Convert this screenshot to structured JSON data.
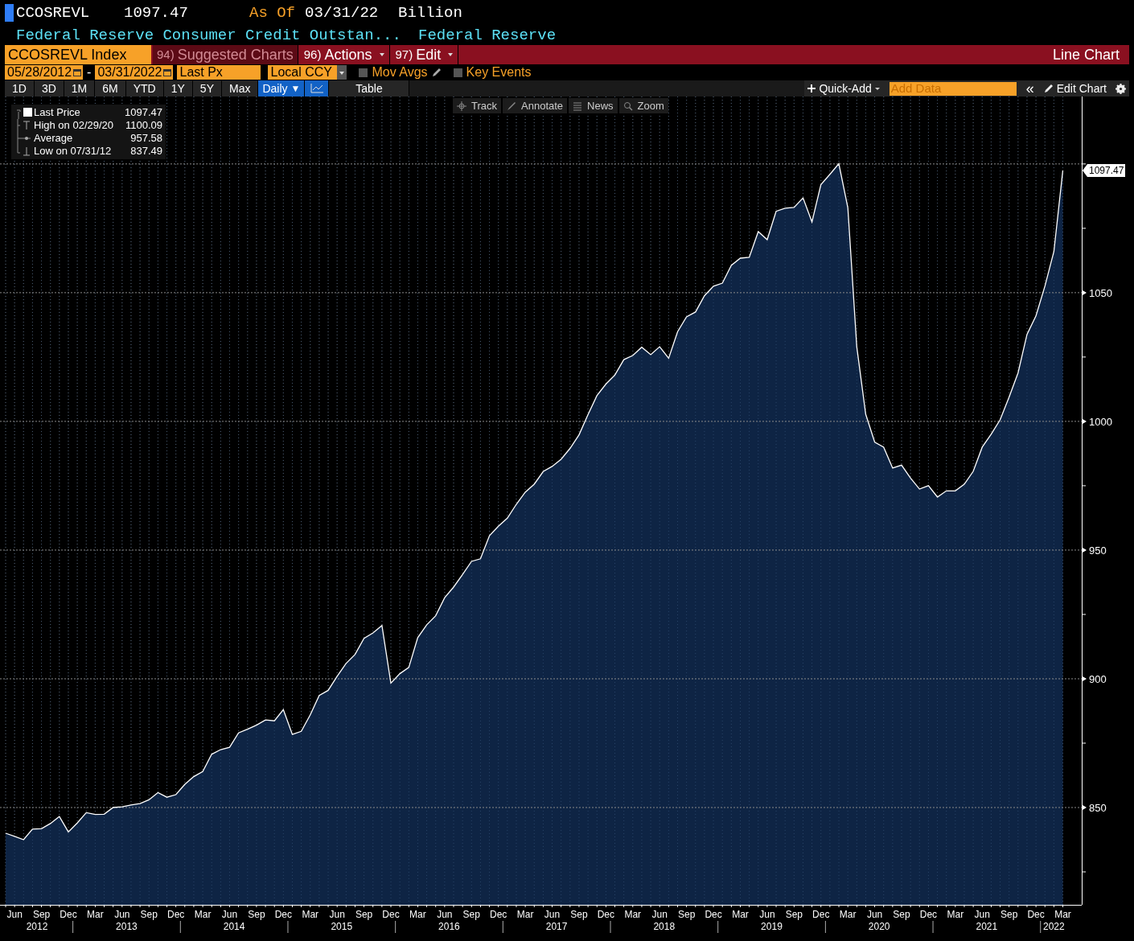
{
  "header": {
    "ticker": "CCOSREVL",
    "price": "1097.47",
    "as_of_label": "As Of",
    "as_of_date": "03/31/22",
    "units": "Billion",
    "description": "Federal Reserve Consumer Credit Outstan...",
    "source": "Federal Reserve"
  },
  "toolbar": {
    "security": "CCOSREVL Index",
    "menus": [
      {
        "number": "94)",
        "label": "Suggested Charts",
        "disabled": true,
        "dropdown": false
      },
      {
        "number": "96)",
        "label": "Actions",
        "disabled": false,
        "dropdown": true
      },
      {
        "number": "97)",
        "label": "Edit",
        "disabled": false,
        "dropdown": true
      }
    ],
    "chart_type": "Line Chart"
  },
  "range": {
    "start": "05/28/2012",
    "separator": "-",
    "end": "03/31/2022",
    "field": "Last Px",
    "currency": "Local CCY",
    "options": [
      {
        "label": "Mov Avgs",
        "checked": false,
        "kind": "pencil"
      },
      {
        "label": "Key Events",
        "checked": false,
        "kind": "plain"
      }
    ]
  },
  "periods": [
    {
      "label": "1D",
      "selected": false
    },
    {
      "label": "3D",
      "selected": false
    },
    {
      "label": "1M",
      "selected": false
    },
    {
      "label": "6M",
      "selected": false
    },
    {
      "label": "YTD",
      "selected": false
    },
    {
      "label": "1Y",
      "selected": false
    },
    {
      "label": "5Y",
      "selected": false
    },
    {
      "label": "Max",
      "selected": false
    }
  ],
  "frequency": {
    "label": "Daily",
    "caret": "▼"
  },
  "view_buttons": [
    {
      "kind": "chart",
      "selected": true
    },
    {
      "kind": "text",
      "label": "Table",
      "selected": false
    }
  ],
  "actions": {
    "quick_add": "Quick-Add",
    "add_data_placeholder": "Add Data",
    "collapse": "«",
    "edit_chart": "Edit Chart"
  },
  "chart_tools": [
    {
      "kind": "track",
      "label": "Track"
    },
    {
      "kind": "annotate",
      "label": "Annotate"
    },
    {
      "kind": "news",
      "label": "News"
    },
    {
      "kind": "zoom",
      "label": "Zoom"
    }
  ],
  "legend": [
    {
      "kind": "last",
      "label": "Last Price",
      "value": "1097.47"
    },
    {
      "kind": "high",
      "label": "High on 02/29/20",
      "value": "1100.09"
    },
    {
      "kind": "average",
      "label": "Average",
      "value": "957.58"
    },
    {
      "kind": "low",
      "label": "Low on 07/31/12",
      "value": "837.49"
    }
  ],
  "last_value_tag": "1097.47",
  "x_axis": {
    "months": [
      "Jun",
      "Sep",
      "Dec",
      "Mar",
      "Jun",
      "Sep",
      "Dec",
      "Mar",
      "Jun",
      "Sep",
      "Dec",
      "Mar",
      "Jun",
      "Sep",
      "Dec",
      "Mar",
      "Jun",
      "Sep",
      "Dec",
      "Mar",
      "Jun",
      "Sep",
      "Dec",
      "Mar",
      "Jun",
      "Sep",
      "Dec",
      "Mar",
      "Jun",
      "Sep",
      "Dec",
      "Mar",
      "Jun",
      "Sep",
      "Dec",
      "Mar",
      "Jun",
      "Sep",
      "Dec",
      "Mar"
    ],
    "years": [
      "2012",
      "2013",
      "2014",
      "2015",
      "2016",
      "2017",
      "2018",
      "2019",
      "2020",
      "2021",
      "2022"
    ]
  },
  "chart_data": {
    "type": "area",
    "grid": true,
    "ylim": [
      812.2,
      1126.2
    ],
    "yticks": [
      850,
      900,
      950,
      1000,
      1050
    ],
    "series": [
      {
        "color": "#ffffff",
        "values": [
          840.0,
          838.8,
          837.5,
          841.6,
          841.8,
          843.8,
          846.5,
          840.5,
          844.0,
          848.0,
          847.3,
          847.4,
          850.0,
          850.3,
          851.0,
          851.5,
          853.0,
          855.8,
          854.0,
          855.0,
          859.0,
          862.0,
          864.0,
          870.7,
          872.5,
          873.4,
          879.0,
          880.4,
          882.0,
          884.0,
          883.7,
          888.0,
          878.4,
          879.6,
          886.0,
          893.5,
          895.5,
          901.0,
          906.0,
          909.5,
          915.7,
          917.8,
          920.7,
          898.3,
          902.0,
          904.4,
          916.0,
          921.0,
          924.5,
          931.5,
          935.6,
          940.5,
          945.6,
          946.6,
          955.6,
          959.3,
          962.4,
          967.8,
          972.5,
          975.6,
          980.5,
          982.5,
          985.3,
          989.5,
          994.8,
          1002.6,
          1010.0,
          1014.5,
          1018.0,
          1024.0,
          1025.6,
          1028.8,
          1025.9,
          1029.0,
          1024.5,
          1034.8,
          1040.6,
          1042.5,
          1048.8,
          1052.5,
          1053.7,
          1060.6,
          1063.4,
          1063.7,
          1073.7,
          1070.6,
          1081.6,
          1082.8,
          1083.1,
          1086.8,
          1077.5,
          1092.0,
          1096.0,
          1100.1,
          1083.0,
          1029.0,
          1002.8,
          991.9,
          990.0,
          981.9,
          983.0,
          978.0,
          973.7,
          975.0,
          970.6,
          973.0,
          973.0,
          975.6,
          980.6,
          990.0,
          995.0,
          1000.6,
          1009.4,
          1018.8,
          1033.8,
          1041.0,
          1052.5,
          1066.0,
          1097.5
        ]
      }
    ]
  }
}
